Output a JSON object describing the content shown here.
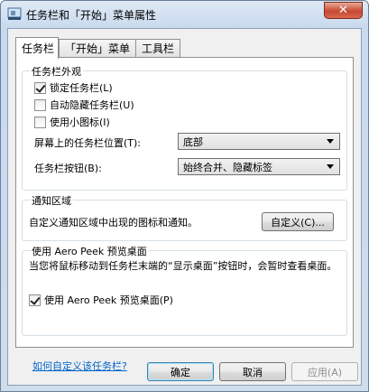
{
  "window": {
    "title": "任务栏和「开始」菜单属性",
    "close_label": "✕"
  },
  "tabs": [
    {
      "label": "任务栏",
      "active": true
    },
    {
      "label": "「开始」菜单",
      "active": false
    },
    {
      "label": "工具栏",
      "active": false
    }
  ],
  "appearance": {
    "title": "任务栏外观",
    "lock_taskbar": {
      "label": "锁定任务栏(L)",
      "checked": true
    },
    "auto_hide": {
      "label": "自动隐藏任务栏(U)",
      "checked": false
    },
    "small_icons": {
      "label": "使用小图标(I)",
      "checked": false
    },
    "location_label": "屏幕上的任务栏位置(T):",
    "location_value": "底部",
    "buttons_label": "任务栏按钮(B):",
    "buttons_value": "始终合并、隐藏标签"
  },
  "notification": {
    "title": "通知区域",
    "description": "自定义通知区域中出现的图标和通知。",
    "customize_button": "自定义(C)..."
  },
  "aero_peek": {
    "title": "使用 Aero Peek 预览桌面",
    "description": "当您将鼠标移动到任务栏末端的“显示桌面”按钮时，会暂时查看桌面。",
    "use_peek": {
      "label": "使用 Aero Peek 预览桌面(P)",
      "checked": true
    }
  },
  "help_link": "如何自定义该任务栏?",
  "footer": {
    "ok": "确定",
    "cancel": "取消",
    "apply": "应用(A)"
  }
}
